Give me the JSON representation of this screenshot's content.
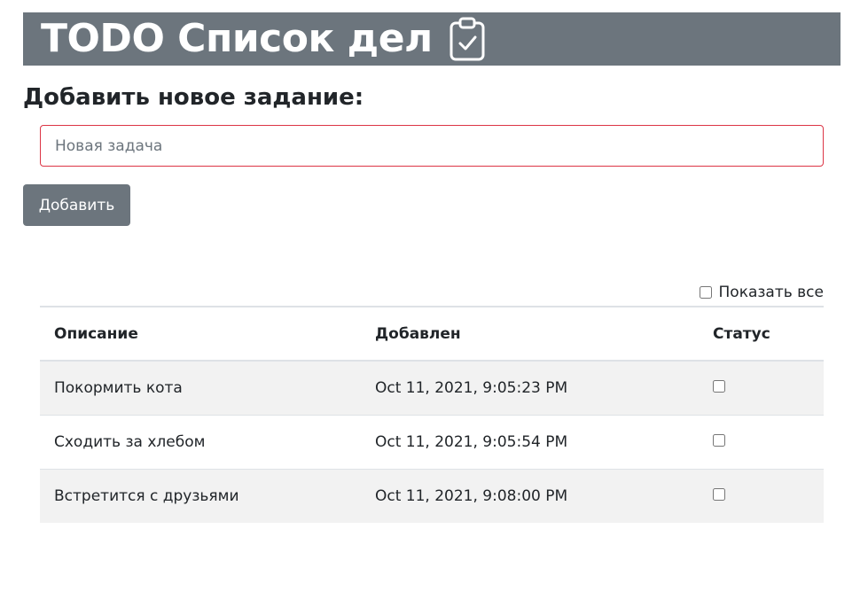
{
  "header": {
    "title": "TODO Список дел",
    "icon": "clipboard-check-icon"
  },
  "add_form": {
    "heading": "Добавить новое задание:",
    "input_placeholder": "Новая задача",
    "input_value": "",
    "button_label": "Добавить"
  },
  "filter": {
    "show_all_label": "Показать все",
    "show_all_checked": false
  },
  "table": {
    "columns": [
      "Описание",
      "Добавлен",
      "Статус"
    ],
    "rows": [
      {
        "description": "Покормить кота",
        "added": "Oct 11, 2021, 9:05:23 PM",
        "done": false
      },
      {
        "description": "Сходить за хлебом",
        "added": "Oct 11, 2021, 9:05:54 PM",
        "done": false
      },
      {
        "description": "Встретится с друзьями",
        "added": "Oct 11, 2021, 9:08:00 PM",
        "done": false
      }
    ]
  },
  "colors": {
    "header_bg": "#6c757d",
    "input_border": "#dc3545",
    "stripe": "#f2f2f2"
  }
}
